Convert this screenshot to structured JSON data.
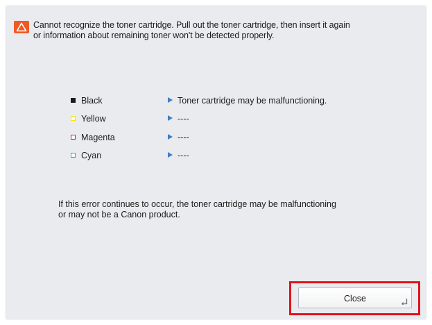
{
  "dialog": {
    "message_lines": [
      "Cannot recognize the toner cartridge. Pull out the toner cartridge, then insert it again",
      "or information about remaining toner won't be detected properly."
    ],
    "warning_icon": "warning-triangle-icon",
    "accent_color": "#ef5a24"
  },
  "toners": [
    {
      "color": "Black",
      "swatch": "#1a1a1a",
      "status": "Toner cartridge may be malfunctioning."
    },
    {
      "color": "Yellow",
      "swatch": "#f5e400",
      "status": "----"
    },
    {
      "color": "Magenta",
      "swatch": "#e4007f",
      "status": "----"
    },
    {
      "color": "Cyan",
      "swatch": "#00b7d6",
      "status": "----"
    }
  ],
  "footer": {
    "lines": [
      "If this error continues to occur, the toner cartridge may be malfunctioning",
      "or may not be a Canon product."
    ]
  },
  "actions": {
    "close_label": "Close",
    "highlight_color": "#e2121b"
  }
}
